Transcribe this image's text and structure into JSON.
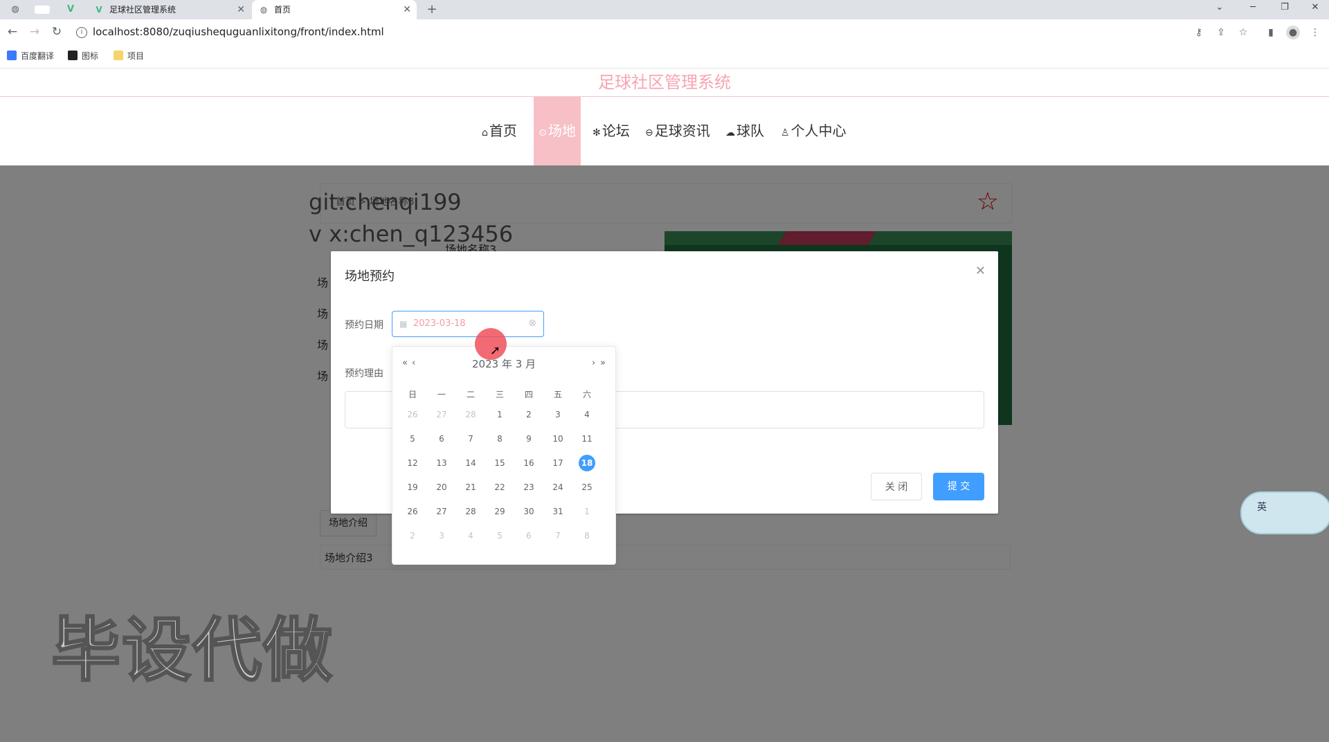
{
  "browser": {
    "tabs": [
      {
        "label": "足球社区管理系统",
        "active": false
      },
      {
        "label": "首页",
        "active": true
      }
    ],
    "url": "localhost:8080/zuqiushequguanlixitong/front/index.html",
    "bookmarks": [
      "百度翻译",
      "图标",
      "项目"
    ]
  },
  "site": {
    "title": "足球社区管理系统",
    "nav": [
      {
        "label": "首页",
        "icon": "home-icon",
        "active": false
      },
      {
        "label": "场地",
        "icon": "field-icon",
        "active": true
      },
      {
        "label": "论坛",
        "icon": "snow-icon",
        "active": false
      },
      {
        "label": "足球资讯",
        "icon": "news-icon",
        "active": false
      },
      {
        "label": "球队",
        "icon": "cloud-icon",
        "active": false
      },
      {
        "label": "个人中心",
        "icon": "user-icon",
        "active": false
      }
    ]
  },
  "page": {
    "breadcrumb": "首页 > 场地名称3",
    "field_name": "场地名称3",
    "detail_labels": [
      "场",
      "场",
      "场",
      "场"
    ],
    "intro_tab": "场地介绍",
    "intro_text": "场地介绍3"
  },
  "watermark": {
    "line1": "git:chenqi199",
    "line2": "v x:chen_q123456",
    "big": "毕设代做"
  },
  "dialog": {
    "title": "场地预约",
    "date_label": "预约日期",
    "date_value": "2023-03-18",
    "reason_label": "预约理由",
    "close_button": "关 闭",
    "submit_button": "提 交"
  },
  "picker": {
    "header": "2023 年  3 月",
    "weekdays": [
      "日",
      "一",
      "二",
      "三",
      "四",
      "五",
      "六"
    ],
    "days": [
      [
        "26",
        "27",
        "28",
        "1",
        "2",
        "3",
        "4"
      ],
      [
        "5",
        "6",
        "7",
        "8",
        "9",
        "10",
        "11"
      ],
      [
        "12",
        "13",
        "14",
        "15",
        "16",
        "17",
        "18"
      ],
      [
        "19",
        "20",
        "21",
        "22",
        "23",
        "24",
        "25"
      ],
      [
        "26",
        "27",
        "28",
        "29",
        "30",
        "31",
        "1"
      ],
      [
        "2",
        "3",
        "4",
        "5",
        "6",
        "7",
        "8"
      ]
    ],
    "selected": "18"
  },
  "ime": {
    "label": "英"
  },
  "colors": {
    "accent": "#409eff",
    "nav_active": "#f7c0c7",
    "title": "#f7a5b1"
  }
}
